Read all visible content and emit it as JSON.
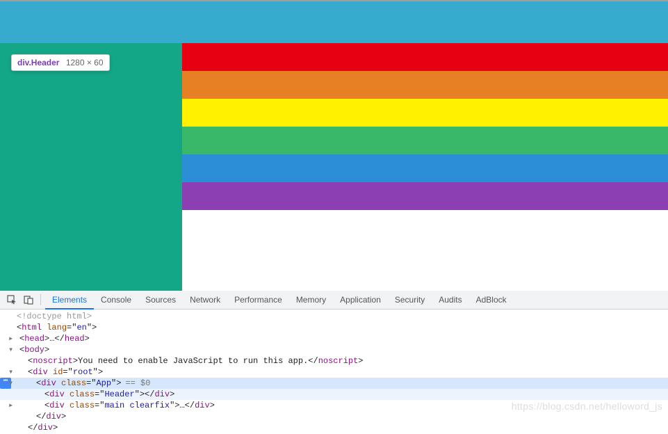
{
  "tooltip": {
    "element": "div.Header",
    "dimensions": "1280 × 60"
  },
  "stripes": {
    "red": "#e60012",
    "orange": "#e77f24",
    "yellow": "#fff100",
    "green": "#38b868",
    "blue": "#2c8ed6",
    "purple": "#8b3fb2"
  },
  "devtools": {
    "tabs": {
      "elements": "Elements",
      "console": "Console",
      "sources": "Sources",
      "network": "Network",
      "performance": "Performance",
      "memory": "Memory",
      "application": "Application",
      "security": "Security",
      "audits": "Audits",
      "adblock": "AdBlock"
    },
    "active_tab": "elements"
  },
  "dom": {
    "doctype": "<!doctype html>",
    "html_open": "<html lang=\"en\">",
    "head": "<head>…</head>",
    "body_open": "<body>",
    "noscript_text": "You need to enable JavaScript to run this app.",
    "root_open": "<div id=\"root\">",
    "app_open": "<div class=\"App\">",
    "app_eq": "== $0",
    "header_div": "<div class=\"Header\"></div>",
    "main_div": "<div class=\"main clearfix\">…</div>",
    "div_close": "</div>"
  },
  "watermark": "https://blog.csdn.net/helloword_js"
}
